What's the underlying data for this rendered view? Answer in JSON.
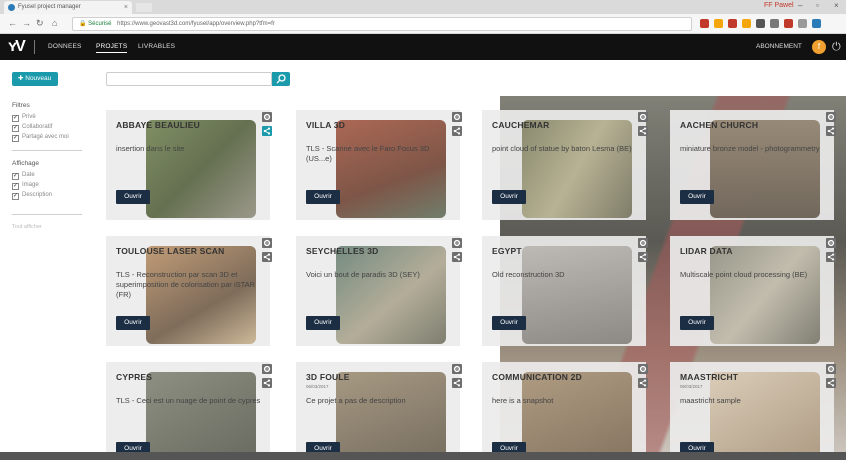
{
  "browser": {
    "tab_title": "Fyusel project manager",
    "tab_close": "×",
    "profile": "FF Pawel",
    "url_secure_label": "Sécurisé",
    "url": "https://www.geovast3d.com/fyusel/app/overview.php?tfm=fr",
    "win_min": "–",
    "win_max": "▫",
    "win_close": "×",
    "back": "←",
    "forward": "→",
    "reload": "↻",
    "home": "⌂",
    "ext_colors": [
      "#c0392b",
      "#f4a60c",
      "#c0392b",
      "#f4a60c",
      "#555555",
      "#777777",
      "#c0392b",
      "#999999",
      "#2b7bb9"
    ]
  },
  "header": {
    "logo": "ʏV",
    "nav": [
      {
        "label": "DONNEES"
      },
      {
        "label": "PROJETS"
      },
      {
        "label": "LIVRABLES"
      }
    ],
    "subscription": "ABONNEMENT",
    "avatar_initial": "f",
    "power": "⏻"
  },
  "sidebar": {
    "new_button": "✚ Nouveau",
    "filters_title": "Filtres",
    "filters": [
      {
        "label": "Privé",
        "checked": "✓"
      },
      {
        "label": "Collaboratif",
        "checked": "✓"
      },
      {
        "label": "Partagé avec moi",
        "checked": "✓"
      }
    ],
    "display_title": "Affichage",
    "display": [
      {
        "label": "Date",
        "checked": "✓"
      },
      {
        "label": "Image",
        "checked": "✓"
      },
      {
        "label": "Description",
        "checked": "✓"
      }
    ],
    "note": "Tout afficher"
  },
  "search": {
    "placeholder": "",
    "value": ""
  },
  "accent": "#1a9aab",
  "cards": [
    {
      "title": "ABBAYE BEAULIEU",
      "date": "",
      "desc": "insertion dans le site",
      "open": "Ouvrir"
    },
    {
      "title": "VILLA 3D",
      "date": "",
      "desc": "TLS - Scanne avec le Faro Focus 3D (US...e)",
      "open": "Ouvrir"
    },
    {
      "title": "CAUCHEMAR",
      "date": "",
      "desc": "point cloud of statue by baton Lesma (BE)",
      "open": "Ouvrir"
    },
    {
      "title": "AACHEN CHURCH",
      "date": "",
      "desc": "miniature bronze model - photogrammetry",
      "open": "Ouvrir"
    },
    {
      "title": "TOULOUSE LASER SCAN",
      "date": "",
      "desc": "TLS - Reconstruction par scan 3D et superimposition de colorisation par iSTAR (FR)",
      "open": "Ouvrir"
    },
    {
      "title": "SEYCHELLES 3D",
      "date": "",
      "desc": "Voici un bout de paradis 3D (SEY)",
      "open": "Ouvrir"
    },
    {
      "title": "EGYPT",
      "date": "",
      "desc": "Old reconstruction 3D",
      "open": "Ouvrir"
    },
    {
      "title": "LIDAR DATA",
      "date": "",
      "desc": "Multiscale point cloud processing (BE)",
      "open": "Ouvrir"
    },
    {
      "title": "CYPRES",
      "date": "",
      "desc": "TLS - Ceci est un nuage de point de cypres",
      "open": "Ouvrir"
    },
    {
      "title": "3D FOULE",
      "date": "06/03/2017",
      "desc": "Ce projet a pas de description",
      "open": "Ouvrir"
    },
    {
      "title": "COMMUNICATION 2D",
      "date": "",
      "desc": "here is a snapshot",
      "open": "Ouvrir"
    },
    {
      "title": "MAASTRICHT",
      "date": "06/03/2017",
      "desc": "maastricht sample",
      "open": "Ouvrir"
    }
  ]
}
